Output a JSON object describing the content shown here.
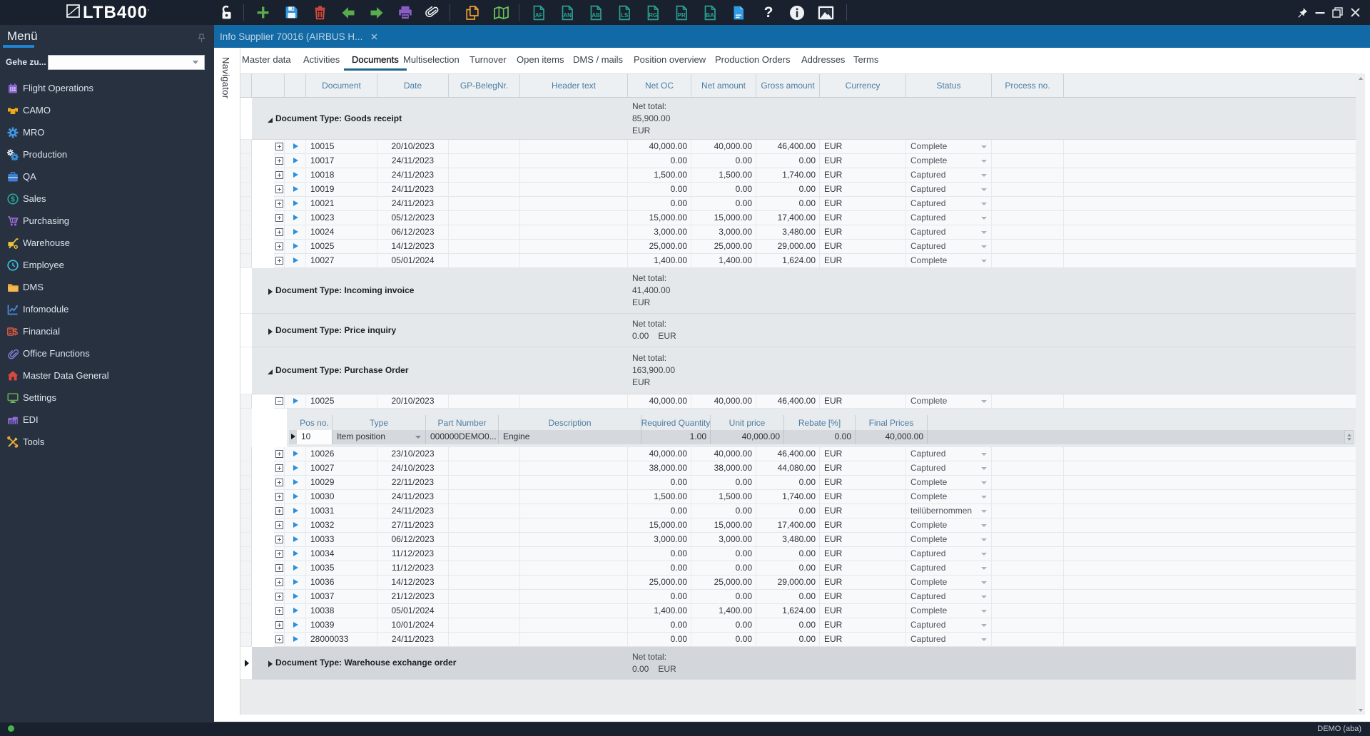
{
  "app": {
    "logo_text": "LTB400",
    "user": "DEMO (aba)"
  },
  "colors": {
    "chrome_dark": "#1a212e",
    "sidebar": "#273140",
    "tab_blue": "#1169a5",
    "accent_blue": "#1f83d3",
    "subtab_underline": "#1d6591",
    "group_row": "#e5e8ea",
    "selected_row": "#d3d7db",
    "status_green": "#47b54c"
  },
  "toolbar": {
    "buttons": [
      {
        "name": "lock",
        "icon": "lock"
      },
      {
        "name": "add",
        "icon": "add"
      },
      {
        "name": "save",
        "icon": "save"
      },
      {
        "name": "delete",
        "icon": "trash"
      },
      {
        "name": "back",
        "icon": "arrow-left"
      },
      {
        "name": "forward",
        "icon": "arrow-right"
      },
      {
        "name": "print",
        "icon": "printer"
      },
      {
        "name": "attachment",
        "icon": "paperclip"
      },
      {
        "name": "copy",
        "icon": "copy"
      },
      {
        "name": "map",
        "icon": "map"
      },
      {
        "name": "doc-af",
        "icon": "doc-letter",
        "letter": "AF"
      },
      {
        "name": "doc-an",
        "icon": "doc-letter",
        "letter": "AN"
      },
      {
        "name": "doc-ab",
        "icon": "doc-letter",
        "letter": "AB"
      },
      {
        "name": "doc-ls",
        "icon": "doc-letter",
        "letter": "LS"
      },
      {
        "name": "doc-rg",
        "icon": "doc-letter",
        "letter": "RG"
      },
      {
        "name": "doc-pr",
        "icon": "doc-letter",
        "letter": "PR"
      },
      {
        "name": "doc-ba",
        "icon": "doc-letter",
        "letter": "BA"
      },
      {
        "name": "document",
        "icon": "doc-blue"
      },
      {
        "name": "help",
        "icon": "help"
      },
      {
        "name": "info",
        "icon": "info"
      },
      {
        "name": "image",
        "icon": "image"
      }
    ],
    "window_buttons": [
      {
        "name": "pin",
        "icon": "pin"
      },
      {
        "name": "minimize",
        "icon": "minimize"
      },
      {
        "name": "restore",
        "icon": "restore"
      },
      {
        "name": "close",
        "icon": "close"
      }
    ]
  },
  "sidebar": {
    "title": "Menü",
    "goto_label": "Gehe zu...",
    "goto_value": "",
    "items": [
      {
        "label": "Flight Operations",
        "icon": "calendar"
      },
      {
        "label": "CAMO",
        "icon": "camo"
      },
      {
        "label": "MRO",
        "icon": "gear"
      },
      {
        "label": "Production",
        "icon": "gears"
      },
      {
        "label": "QA",
        "icon": "case"
      },
      {
        "label": "Sales",
        "icon": "dollar-circle"
      },
      {
        "label": "Purchasing",
        "icon": "cart"
      },
      {
        "label": "Warehouse",
        "icon": "handtruck"
      },
      {
        "label": "Employee",
        "icon": "clock"
      },
      {
        "label": "DMS",
        "icon": "folder"
      },
      {
        "label": "Infomodule",
        "icon": "chart"
      },
      {
        "label": "Financial",
        "icon": "money"
      },
      {
        "label": "Office Functions",
        "icon": "clip"
      },
      {
        "label": "Master Data General",
        "icon": "home"
      },
      {
        "label": "Settings",
        "icon": "monitor"
      },
      {
        "label": "EDI",
        "icon": "bars"
      },
      {
        "label": "Tools",
        "icon": "tools"
      }
    ]
  },
  "tab": {
    "title": "Info Supplier 70016 (AIRBUS H..."
  },
  "navigator_label": "Navigator",
  "subtabs": {
    "selected": "Documents",
    "items": [
      "Master data",
      "Activities",
      "Documents",
      "Multiselection",
      "Turnover",
      "Open items",
      "DMS / mails",
      "Position overview",
      "Production Orders",
      "Addresses",
      "Terms"
    ]
  },
  "grid": {
    "columns": [
      {
        "key": "document",
        "label": "Document"
      },
      {
        "key": "date",
        "label": "Date"
      },
      {
        "key": "gp_beleg",
        "label": "GP-BelegNr."
      },
      {
        "key": "header_text",
        "label": "Header text"
      },
      {
        "key": "net_oc",
        "label": "Net OC"
      },
      {
        "key": "net_amount",
        "label": "Net amount"
      },
      {
        "key": "gross_amount",
        "label": "Gross amount"
      },
      {
        "key": "currency",
        "label": "Currency"
      },
      {
        "key": "status",
        "label": "Status"
      },
      {
        "key": "process_no",
        "label": "Process no."
      }
    ],
    "groups": [
      {
        "label": "Document Type: Goods receipt",
        "expanded": true,
        "net_total": {
          "label": "Net total:",
          "value": "85,900.00",
          "currency": "EUR",
          "lines": 3
        },
        "rows": [
          {
            "document": "10015",
            "date": "20/10/2023",
            "gp_beleg": "",
            "header_text": "",
            "net_oc": "40,000.00",
            "net_amount": "40,000.00",
            "gross_amount": "46,400.00",
            "currency": "EUR",
            "status": "Complete",
            "process_no": ""
          },
          {
            "document": "10017",
            "date": "24/11/2023",
            "gp_beleg": "",
            "header_text": "",
            "net_oc": "0.00",
            "net_amount": "0.00",
            "gross_amount": "0.00",
            "currency": "EUR",
            "status": "Complete",
            "process_no": ""
          },
          {
            "document": "10018",
            "date": "24/11/2023",
            "gp_beleg": "",
            "header_text": "",
            "net_oc": "1,500.00",
            "net_amount": "1,500.00",
            "gross_amount": "1,740.00",
            "currency": "EUR",
            "status": "Captured",
            "process_no": ""
          },
          {
            "document": "10019",
            "date": "24/11/2023",
            "gp_beleg": "",
            "header_text": "",
            "net_oc": "0.00",
            "net_amount": "0.00",
            "gross_amount": "0.00",
            "currency": "EUR",
            "status": "Captured",
            "process_no": ""
          },
          {
            "document": "10021",
            "date": "24/11/2023",
            "gp_beleg": "",
            "header_text": "",
            "net_oc": "0.00",
            "net_amount": "0.00",
            "gross_amount": "0.00",
            "currency": "EUR",
            "status": "Captured",
            "process_no": ""
          },
          {
            "document": "10023",
            "date": "05/12/2023",
            "gp_beleg": "",
            "header_text": "",
            "net_oc": "15,000.00",
            "net_amount": "15,000.00",
            "gross_amount": "17,400.00",
            "currency": "EUR",
            "status": "Captured",
            "process_no": ""
          },
          {
            "document": "10024",
            "date": "06/12/2023",
            "gp_beleg": "",
            "header_text": "",
            "net_oc": "3,000.00",
            "net_amount": "3,000.00",
            "gross_amount": "3,480.00",
            "currency": "EUR",
            "status": "Captured",
            "process_no": ""
          },
          {
            "document": "10025",
            "date": "14/12/2023",
            "gp_beleg": "",
            "header_text": "",
            "net_oc": "25,000.00",
            "net_amount": "25,000.00",
            "gross_amount": "29,000.00",
            "currency": "EUR",
            "status": "Captured",
            "process_no": ""
          },
          {
            "document": "10027",
            "date": "05/01/2024",
            "gp_beleg": "",
            "header_text": "",
            "net_oc": "1,400.00",
            "net_amount": "1,400.00",
            "gross_amount": "1,624.00",
            "currency": "EUR",
            "status": "Complete",
            "process_no": ""
          }
        ]
      },
      {
        "label": "Document Type: Incoming invoice",
        "expanded": false,
        "net_total": {
          "label": "Net total:",
          "value": "41,400.00",
          "currency": "EUR",
          "lines": 3
        },
        "rows": []
      },
      {
        "label": "Document Type: Price inquiry",
        "expanded": false,
        "net_total": {
          "label": "Net total:",
          "value": "0.00",
          "currency": "EUR",
          "lines": 2
        },
        "rows": []
      },
      {
        "label": "Document Type: Purchase Order",
        "expanded": true,
        "net_total": {
          "label": "Net total:",
          "value": "163,900.00",
          "currency": "EUR",
          "lines": 3
        },
        "rows": [
          {
            "document": "10025",
            "date": "20/10/2023",
            "gp_beleg": "",
            "header_text": "",
            "net_oc": "40,000.00",
            "net_amount": "40,000.00",
            "gross_amount": "46,400.00",
            "currency": "EUR",
            "status": "Complete",
            "process_no": "",
            "expanded": true
          },
          {
            "document": "10026",
            "date": "23/10/2023",
            "gp_beleg": "",
            "header_text": "",
            "net_oc": "40,000.00",
            "net_amount": "40,000.00",
            "gross_amount": "46,400.00",
            "currency": "EUR",
            "status": "Captured",
            "process_no": ""
          },
          {
            "document": "10027",
            "date": "24/10/2023",
            "gp_beleg": "",
            "header_text": "",
            "net_oc": "38,000.00",
            "net_amount": "38,000.00",
            "gross_amount": "44,080.00",
            "currency": "EUR",
            "status": "Captured",
            "process_no": ""
          },
          {
            "document": "10029",
            "date": "22/11/2023",
            "gp_beleg": "",
            "header_text": "",
            "net_oc": "0.00",
            "net_amount": "0.00",
            "gross_amount": "0.00",
            "currency": "EUR",
            "status": "Complete",
            "process_no": ""
          },
          {
            "document": "10030",
            "date": "24/11/2023",
            "gp_beleg": "",
            "header_text": "",
            "net_oc": "1,500.00",
            "net_amount": "1,500.00",
            "gross_amount": "1,740.00",
            "currency": "EUR",
            "status": "Complete",
            "process_no": ""
          },
          {
            "document": "10031",
            "date": "24/11/2023",
            "gp_beleg": "",
            "header_text": "",
            "net_oc": "0.00",
            "net_amount": "0.00",
            "gross_amount": "0.00",
            "currency": "EUR",
            "status": "teilübernommen",
            "process_no": ""
          },
          {
            "document": "10032",
            "date": "27/11/2023",
            "gp_beleg": "",
            "header_text": "",
            "net_oc": "15,000.00",
            "net_amount": "15,000.00",
            "gross_amount": "17,400.00",
            "currency": "EUR",
            "status": "Complete",
            "process_no": ""
          },
          {
            "document": "10033",
            "date": "06/12/2023",
            "gp_beleg": "",
            "header_text": "",
            "net_oc": "3,000.00",
            "net_amount": "3,000.00",
            "gross_amount": "3,480.00",
            "currency": "EUR",
            "status": "Complete",
            "process_no": ""
          },
          {
            "document": "10034",
            "date": "11/12/2023",
            "gp_beleg": "",
            "header_text": "",
            "net_oc": "0.00",
            "net_amount": "0.00",
            "gross_amount": "0.00",
            "currency": "EUR",
            "status": "Captured",
            "process_no": ""
          },
          {
            "document": "10035",
            "date": "11/12/2023",
            "gp_beleg": "",
            "header_text": "",
            "net_oc": "0.00",
            "net_amount": "0.00",
            "gross_amount": "0.00",
            "currency": "EUR",
            "status": "Captured",
            "process_no": ""
          },
          {
            "document": "10036",
            "date": "14/12/2023",
            "gp_beleg": "",
            "header_text": "",
            "net_oc": "25,000.00",
            "net_amount": "25,000.00",
            "gross_amount": "29,000.00",
            "currency": "EUR",
            "status": "Complete",
            "process_no": ""
          },
          {
            "document": "10037",
            "date": "21/12/2023",
            "gp_beleg": "",
            "header_text": "",
            "net_oc": "0.00",
            "net_amount": "0.00",
            "gross_amount": "0.00",
            "currency": "EUR",
            "status": "Captured",
            "process_no": ""
          },
          {
            "document": "10038",
            "date": "05/01/2024",
            "gp_beleg": "",
            "header_text": "",
            "net_oc": "1,400.00",
            "net_amount": "1,400.00",
            "gross_amount": "1,624.00",
            "currency": "EUR",
            "status": "Complete",
            "process_no": ""
          },
          {
            "document": "10039",
            "date": "10/01/2024",
            "gp_beleg": "",
            "header_text": "",
            "net_oc": "0.00",
            "net_amount": "0.00",
            "gross_amount": "0.00",
            "currency": "EUR",
            "status": "Captured",
            "process_no": ""
          },
          {
            "document": "28000033",
            "date": "24/11/2023",
            "gp_beleg": "",
            "header_text": "",
            "net_oc": "0.00",
            "net_amount": "0.00",
            "gross_amount": "0.00",
            "currency": "EUR",
            "status": "Captured",
            "process_no": ""
          }
        ]
      },
      {
        "label": "Document Type: Warehouse exchange order",
        "expanded": false,
        "selected": true,
        "net_total": {
          "label": "Net total:",
          "value": "0.00",
          "currency": "EUR",
          "lines": 2
        },
        "rows": []
      }
    ],
    "detail": {
      "columns": [
        {
          "key": "pos_no",
          "label": "Pos no."
        },
        {
          "key": "type",
          "label": "Type"
        },
        {
          "key": "part_number",
          "label": "Part Number"
        },
        {
          "key": "description",
          "label": "Description"
        },
        {
          "key": "required_quantity",
          "label": "Required Quantity"
        },
        {
          "key": "unit_price",
          "label": "Unit price"
        },
        {
          "key": "rebate",
          "label": "Rebate [%]"
        },
        {
          "key": "final_prices",
          "label": "Final Prices"
        }
      ],
      "row": {
        "pos_no": "10",
        "type": "Item position",
        "part_number": "000000DEMO0...",
        "description": "Engine",
        "required_quantity": "1.00",
        "unit_price": "40,000.00",
        "rebate": "0.00",
        "final_prices": "40,000.00"
      }
    }
  }
}
